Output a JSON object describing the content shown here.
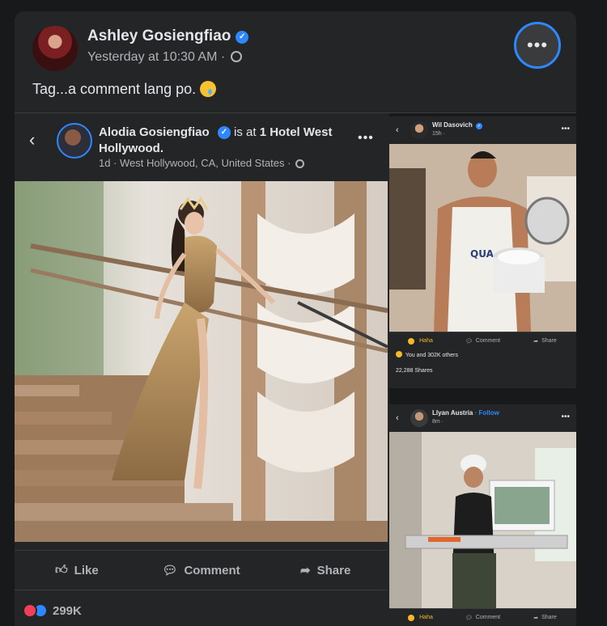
{
  "post": {
    "author": "Ashley Gosiengfiao",
    "time": "Yesterday at 10:30 AM ·",
    "text": "Tag...a comment lang po.",
    "more_label": "•••"
  },
  "shared_post": {
    "back_label": "‹",
    "author": "Alodia Gosiengfiao",
    "checkin_prefix": "is at",
    "location_name": "1 Hotel West Hollywood.",
    "meta": "1d · West Hollywood, CA, United States ·",
    "dots": "•••",
    "actions": {
      "like": "Like",
      "comment": "Comment",
      "share": "Share"
    },
    "reaction_count": "299K"
  },
  "right_top": {
    "author": "Wil Dasovich",
    "time": "15h ·",
    "actions": {
      "haha": "Haha",
      "comment": "Comment",
      "share": "Share"
    },
    "reactions_text": "You and 302K others",
    "shares_text": "22,288 Shares",
    "apron_text": "QUA"
  },
  "right_bottom": {
    "author": "Llyan Austria",
    "follow": "· Follow",
    "time": "8m ·",
    "actions": {
      "haha": "Haha",
      "comment": "Comment",
      "share": "Share"
    }
  },
  "colors": {
    "accent": "#2d88ff",
    "card_bg": "#242526",
    "page_bg": "#18191a",
    "haha": "#f7b928",
    "love": "#f33e58"
  }
}
